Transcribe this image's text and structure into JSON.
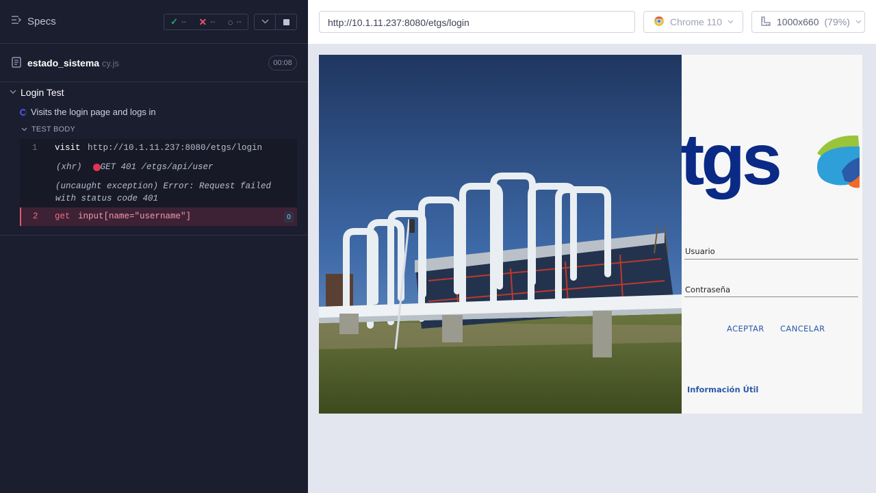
{
  "reporter": {
    "specs_label": "Specs",
    "stats": {
      "passed": "--",
      "failed": "--",
      "pending": "--"
    },
    "spec": {
      "name": "estado_sistema",
      "ext": "cy.js",
      "duration": "00:08"
    },
    "suite": {
      "title": "Login Test"
    },
    "test": {
      "title": "Visits the login page and logs in",
      "section": "TEST BODY"
    },
    "commands": [
      {
        "num": "1",
        "name": "visit",
        "message": "http://10.1.11.237:8080/etgs/login"
      },
      {
        "xhr_prefix": "(xhr)",
        "xhr_text": "GET 401 /etgs/api/user"
      },
      {
        "exception": "(uncaught exception)  Error: Request failed with status code 401"
      },
      {
        "num": "2",
        "name": "get",
        "message": "input[name=\"username\"]",
        "badge": "0"
      }
    ]
  },
  "aut": {
    "url": "http://10.1.11.237:8080/etgs/login",
    "browser": "Chrome 110",
    "viewport": "1000x660",
    "scale": "(79%)"
  },
  "app": {
    "logo_text": "tgs",
    "username_label": "Usuario",
    "password_label": "Contraseña",
    "accept_label": "ACEPTAR",
    "cancel_label": "CANCELAR",
    "info_link": "Información Útil"
  },
  "colors": {
    "reporter_bg": "#1b1e2e",
    "pass": "#1fa971",
    "fail": "#e45770",
    "brand_navy": "#0a2a86",
    "link_blue": "#2a5aa8"
  }
}
